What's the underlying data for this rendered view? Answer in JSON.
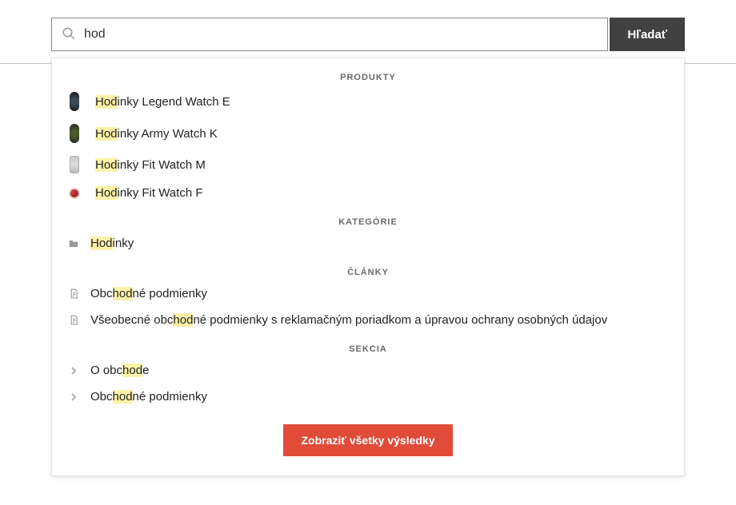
{
  "search": {
    "value": "hod",
    "button_label": "Hľadať"
  },
  "sections": {
    "products_title": "PRODUKTY",
    "categories_title": "KATEGÓRIE",
    "articles_title": "ČLÁNKY",
    "section_title": "SEKCIA"
  },
  "products": [
    {
      "hl": "Hod",
      "rest": "inky Legend Watch E",
      "icon": "watch-legend"
    },
    {
      "hl": "Hod",
      "rest": "inky Army Watch K",
      "icon": "watch-army"
    },
    {
      "hl": "Hod",
      "rest": "inky Fit Watch M",
      "icon": "watch-fit"
    },
    {
      "hl": "Hod",
      "rest": "inky Fit Watch F",
      "icon": "watch-fitf"
    }
  ],
  "categories": [
    {
      "hl": "Hod",
      "rest": "inky"
    }
  ],
  "articles": [
    {
      "pre": "Obc",
      "hl": "hod",
      "rest": "né podmienky"
    },
    {
      "pre": "Všeobecné obc",
      "hl": "hod",
      "rest": "né podmienky s reklamačným poriadkom a úpravou ochrany osobných údajov"
    }
  ],
  "sections_items": [
    {
      "pre": "O obc",
      "hl": "hod",
      "rest": "e"
    },
    {
      "pre": "Obc",
      "hl": "hod",
      "rest": "né podmienky"
    }
  ],
  "show_all_label": "Zobraziť všetky výsledky"
}
